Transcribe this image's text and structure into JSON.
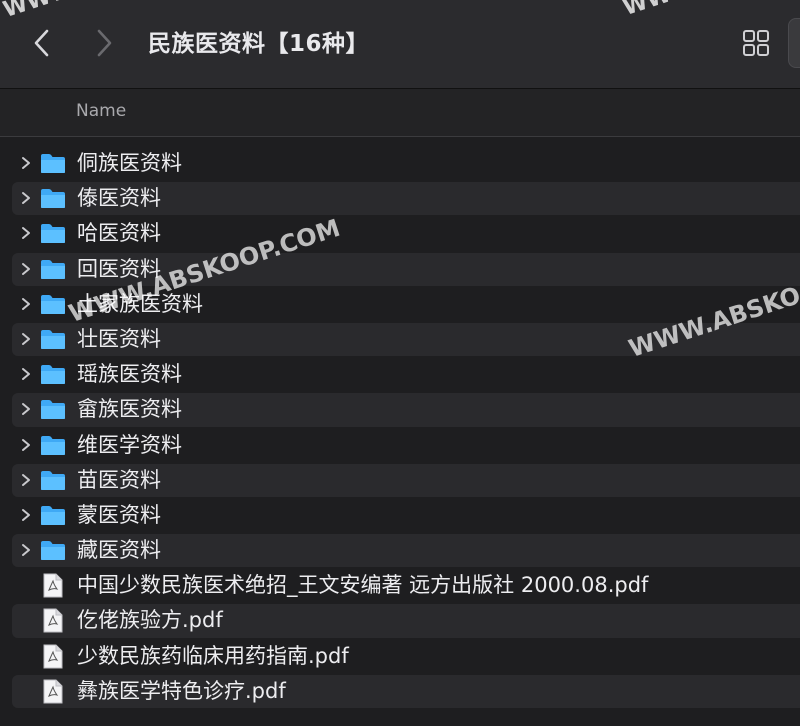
{
  "toolbar": {
    "title": "民族医资料【16种】",
    "back": "chevron-left-icon",
    "forward": "chevron-right-icon",
    "view": "grid-view-icon"
  },
  "header": {
    "name": "Name"
  },
  "items": [
    {
      "type": "folder",
      "label": "侗族医资料"
    },
    {
      "type": "folder",
      "label": "傣医资料"
    },
    {
      "type": "folder",
      "label": "哈医资料"
    },
    {
      "type": "folder",
      "label": "回医资料"
    },
    {
      "type": "folder",
      "label": "土家族医资料"
    },
    {
      "type": "folder",
      "label": "壮医资料"
    },
    {
      "type": "folder",
      "label": "瑶族医资料"
    },
    {
      "type": "folder",
      "label": "畲族医资料"
    },
    {
      "type": "folder",
      "label": "维医学资料"
    },
    {
      "type": "folder",
      "label": "苗医资料"
    },
    {
      "type": "folder",
      "label": "蒙医资料"
    },
    {
      "type": "folder",
      "label": "藏医资料"
    },
    {
      "type": "file",
      "label": "中国少数民族医术绝招_王文安编著 远方出版社 2000.08.pdf"
    },
    {
      "type": "file",
      "label": "仡佬族验方.pdf"
    },
    {
      "type": "file",
      "label": "少数民族药临床用药指南.pdf"
    },
    {
      "type": "file",
      "label": "彝族医学特色诊疗.pdf"
    }
  ],
  "watermark": "WWW.ABSKOOP.COM",
  "watermark_partial": "WWW.ABSKO",
  "colors": {
    "folder": "#3fa9f5",
    "background": "#1e1e20",
    "alt_row": "#2a2a2d"
  }
}
